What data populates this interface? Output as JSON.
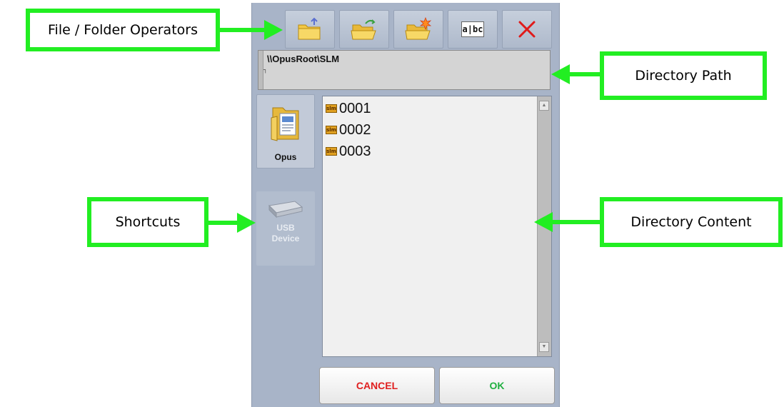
{
  "annotations": {
    "file_folder_operators": "File / Folder Operators",
    "directory_path": "Directory Path",
    "shortcuts": "Shortcuts",
    "directory_content": "Directory Content"
  },
  "toolbar": {
    "icons": [
      "folder-up-icon",
      "open-folder-icon",
      "new-folder-icon",
      "rename-icon",
      "delete-icon"
    ],
    "rename_icon_text": "a|bc"
  },
  "path": {
    "value": "\\\\OpusRoot\\SLM"
  },
  "shortcuts": {
    "opus_label": "Opus",
    "usb_label_line1": "USB",
    "usb_label_line2": "Device"
  },
  "directory": {
    "item_icon_text": "slm",
    "items": [
      "0001",
      "0002",
      "0003"
    ]
  },
  "buttons": {
    "cancel_label": "CANCEL",
    "ok_label": "OK"
  },
  "colors": {
    "annotation_green": "#22ee22",
    "cancel_red": "#e02020",
    "ok_green": "#20b040",
    "panel_bg": "#a8b4c8"
  }
}
